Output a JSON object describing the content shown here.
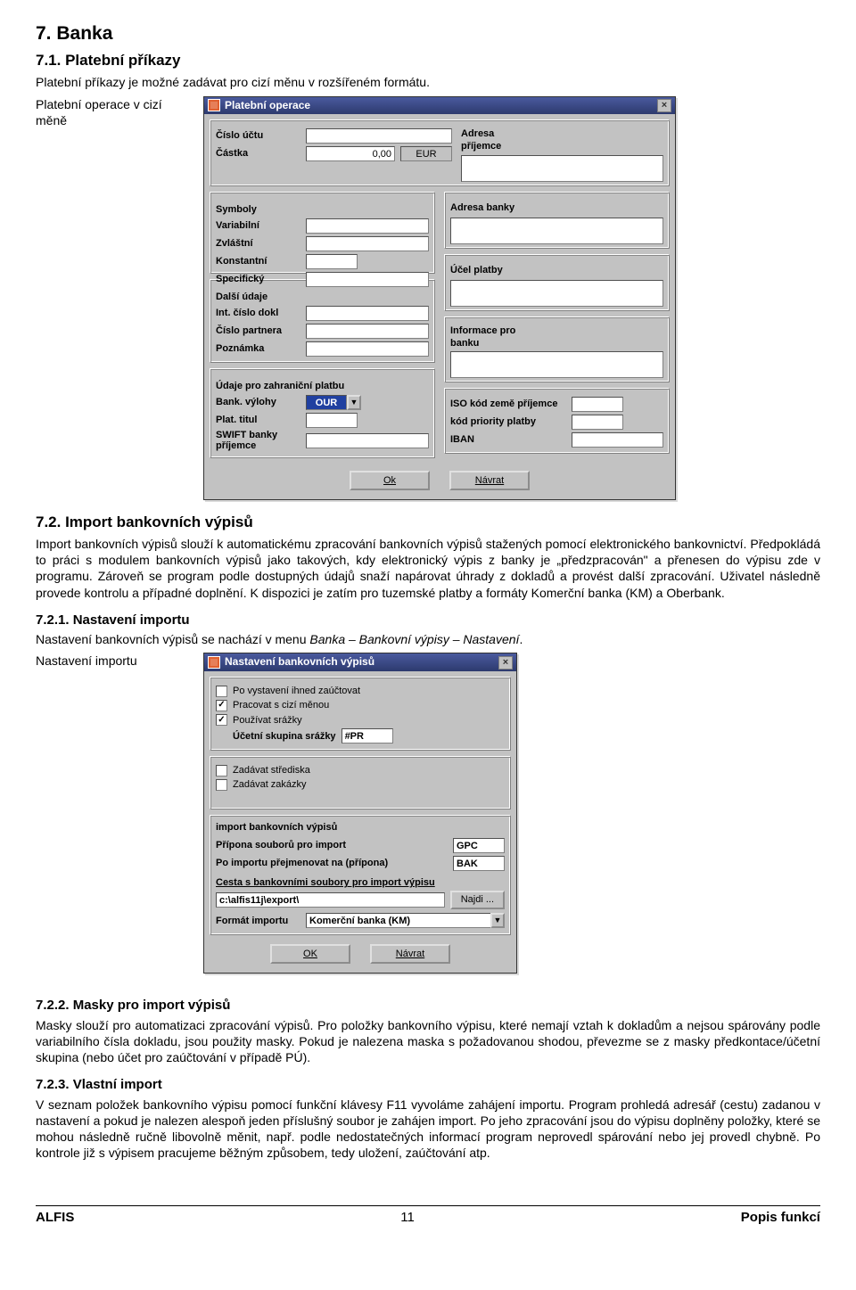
{
  "headings": {
    "h7": "7.   Banka",
    "h71": "7.1.   Platební příkazy",
    "p71": "Platební příkazy je možné zadávat pro cizí měnu v rozšířeném formátu.",
    "cap1": "Platební operace v cizí měně",
    "h72": "7.2.   Import bankovních výpisů",
    "p72": "Import bankovních výpisů slouží k automatickému zpracování bankovních výpisů stažených pomocí elektronického bankovnictví. Předpokládá to práci s modulem bankovních výpisů jako takových, kdy elektronický výpis z banky je „předzpracován\" a přenesen do výpisu zde v programu. Zároveň se program podle dostupných údajů snaží napárovat úhrady z dokladů a provést další zpracování. Uživatel následně provede kontrolu a případné doplnění. K dispozici je zatím pro tuzemské platby a formáty Komerční banka (KM) a Oberbank.",
    "h721": "7.2.1.   Nastavení importu",
    "p721a": "Nastavení bankovních výpisů se nachází v menu ",
    "p721b": "Banka – Bankovní výpisy – Nastavení",
    "p721c": ".",
    "cap2": "Nastavení importu",
    "h722": "7.2.2.   Masky pro import výpisů",
    "p722": "Masky slouží pro automatizaci zpracování výpisů. Pro položky bankovního výpisu, které nemají vztah k dokladům a nejsou spárovány podle variabilního čísla dokladu, jsou použity masky. Pokud je nalezena maska s požadovanou shodou, převezme se z masky předkontace/účetní skupina (nebo účet pro zaúčtování v případě PÚ).",
    "h723": "7.2.3.   Vlastní import",
    "p723": "V seznam položek bankovního výpisu pomocí funkční klávesy F11 vyvoláme zahájení importu. Program prohledá adresář (cestu) zadanou v nastavení a pokud je nalezen alespoň jeden příslušný soubor je zahájen import. Po jeho zpracování jsou do výpisu doplněny položky, které se mohou následně ručně libovolně měnit, např. podle nedostatečných informací program neprovedl spárování nebo jej provedl chybně. Po kontrole již s výpisem pracujeme běžným způsobem, tedy uložení, zaúčtování atp."
  },
  "dialog1": {
    "title": "Platební operace",
    "left_col": {
      "cislo_uctu": "Číslo účtu",
      "castka_lbl": "Částka",
      "castka_val": "0,00",
      "castka_cur": "EUR",
      "symboly": "Symboly",
      "variabilni": "Variabilní",
      "zvlastni": "Zvláštní",
      "konstantni": "Konstantní",
      "specificky": "Specifický",
      "dalsi": "Další údaje",
      "int_cislo": "Int. číslo dokl",
      "cislo_part": "Číslo partnera",
      "poznamka": "Poznámka",
      "zahr": "Údaje pro zahraniční platbu",
      "bank_vylohy": "Bank. výlohy",
      "bank_vylohy_val": "OUR",
      "plat_titul": "Plat. titul",
      "swift": "SWIFT banky příjemce"
    },
    "right_col": {
      "adresa_prij": "Adresa příjemce",
      "adresa_banky": "Adresa banky",
      "ucel": "Účel platby",
      "info_banku": "Informace pro banku",
      "iso_kod": "ISO kód země příjemce",
      "kod_prior": "kód priority platby",
      "iban": "IBAN"
    },
    "buttons": {
      "ok": "Ok",
      "navrat": "Návrat"
    }
  },
  "dialog2": {
    "title": "Nastavení bankovních výpisů",
    "chk1": "Po vystavení ihned zaúčtovat",
    "chk2": "Pracovat s cizí měnou",
    "chk3": "Používat srážky",
    "ucetni_sk": "Účetní skupina srážky",
    "ucetni_sk_val": "#PR",
    "chk4": "Zadávat střediska",
    "chk5": "Zadávat zakázky",
    "imp_section": "import bankovních výpisů",
    "pripona_imp": "Přípona souborů pro import",
    "pripona_imp_val": "GPC",
    "po_importu": "Po importu přejmenovat na (přípona)",
    "po_importu_val": "BAK",
    "cesta_lbl": "Cesta s bankovními soubory pro import výpisu",
    "cesta_val": "c:\\alfis11j\\export\\",
    "najdi": "Najdi ...",
    "format_imp": "Formát importu",
    "format_imp_val": "Komerční banka (KM)",
    "buttons": {
      "ok": "OK",
      "navrat": "Návrat"
    }
  },
  "footer": {
    "left": "ALFIS",
    "mid": "11",
    "right": "Popis funkcí"
  }
}
